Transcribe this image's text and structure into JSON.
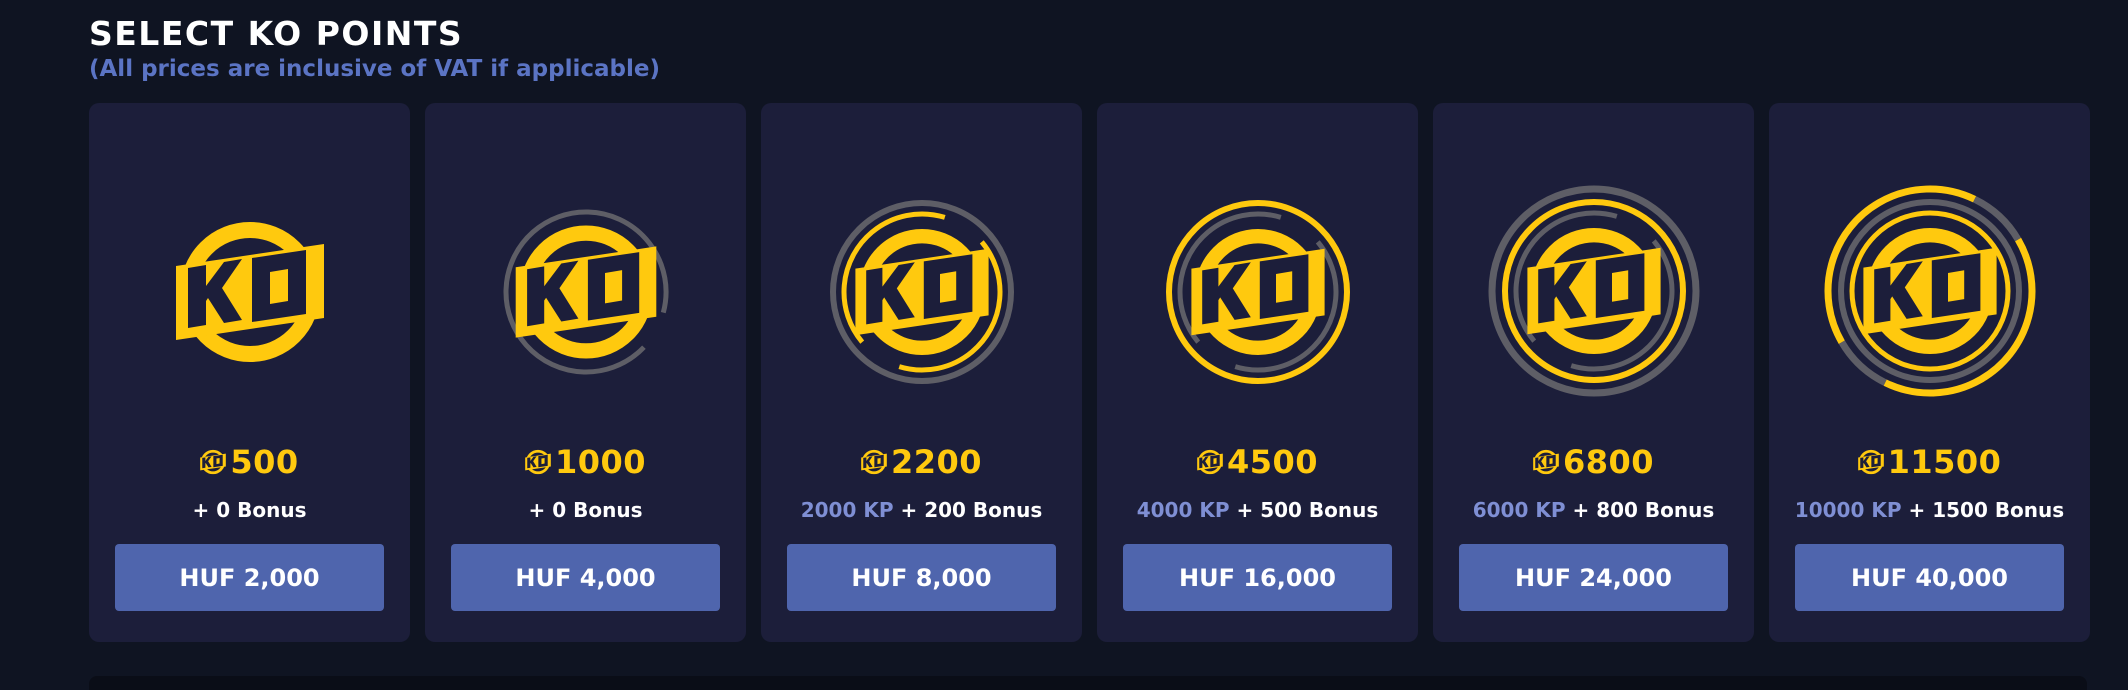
{
  "header": {
    "title": "SELECT KO POINTS",
    "subtitle": "(All prices are inclusive of VAT if applicable)"
  },
  "colors": {
    "accent": "#ffc90e",
    "button": "#4f65ad",
    "card": "#1c1e3a",
    "background": "#0f1422"
  },
  "icons": {
    "coin": "ko-coin-icon"
  },
  "packages": [
    {
      "points": "500",
      "base": "",
      "bonus": "+ 0 Bonus",
      "price": "HUF 2,000"
    },
    {
      "points": "1000",
      "base": "",
      "bonus": "+ 0 Bonus",
      "price": "HUF 4,000"
    },
    {
      "points": "2200",
      "base": "2000 KP",
      "bonus": "+ 200 Bonus",
      "price": "HUF 8,000"
    },
    {
      "points": "4500",
      "base": "4000 KP",
      "bonus": "+ 500 Bonus",
      "price": "HUF 16,000"
    },
    {
      "points": "6800",
      "base": "6000 KP",
      "bonus": "+ 800 Bonus",
      "price": "HUF 24,000"
    },
    {
      "points": "11500",
      "base": "10000 KP",
      "bonus": "+ 1500 Bonus",
      "price": "HUF 40,000"
    }
  ]
}
